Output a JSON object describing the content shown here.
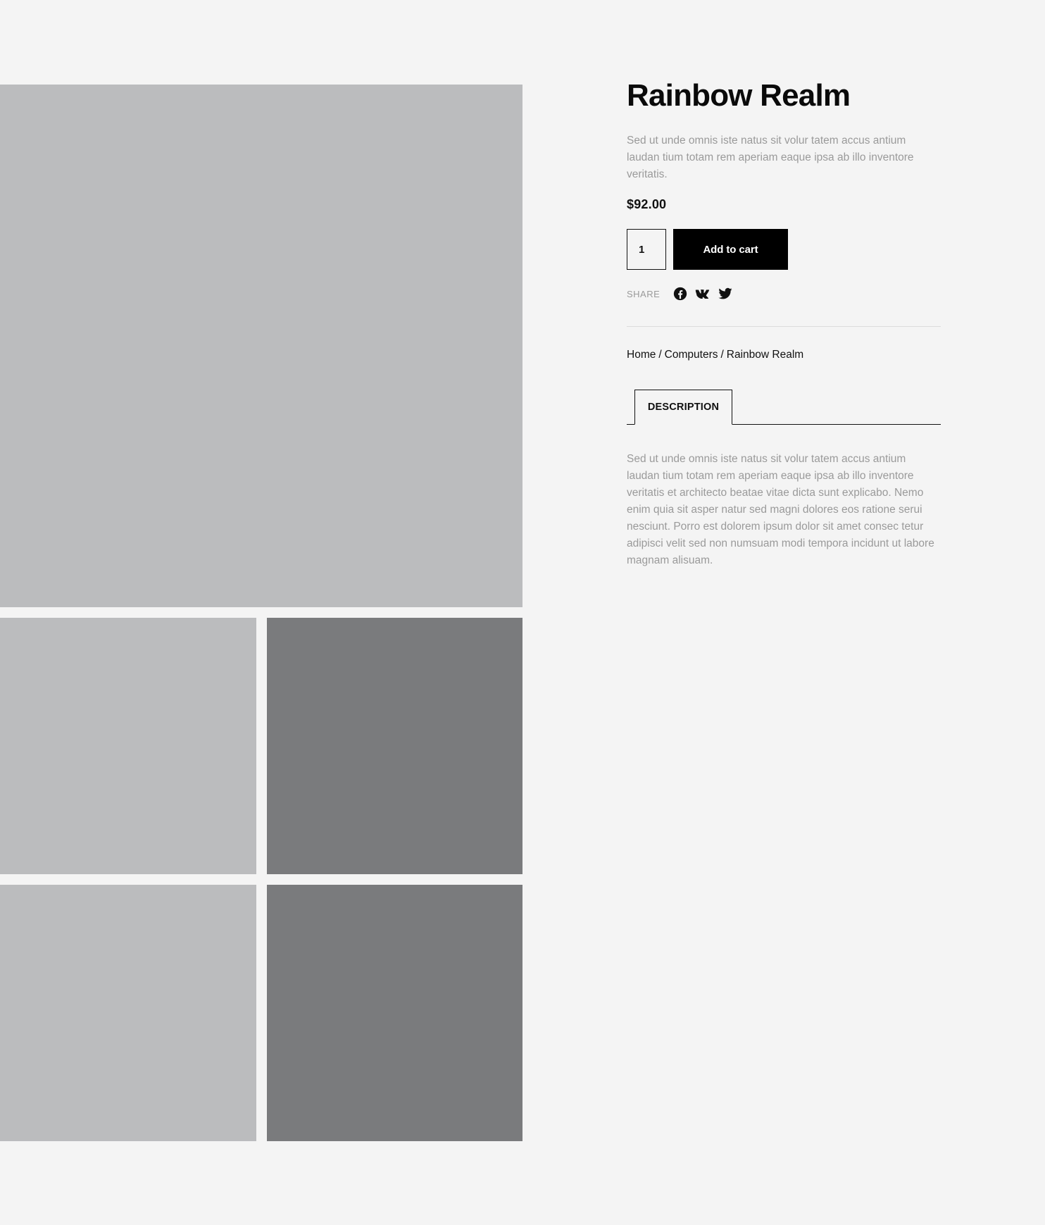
{
  "product": {
    "title": "Rainbow Realm",
    "short_description": "Sed ut unde omnis iste natus sit volur tatem accus antium laudan tium totam rem aperiam eaque ipsa ab illo inventore veritatis.",
    "price": "$92.00",
    "quantity": "1",
    "add_to_cart_label": "Add to cart"
  },
  "share": {
    "label": "SHARE",
    "icons": [
      "facebook-icon",
      "vk-icon",
      "twitter-icon"
    ]
  },
  "breadcrumb": {
    "items": [
      "Home",
      "Computers",
      "Rainbow Realm"
    ],
    "separator": "/"
  },
  "tabs": {
    "active_label": "DESCRIPTION"
  },
  "description": {
    "text": "Sed ut unde omnis iste natus sit volur tatem accus antium laudan tium totam rem aperiam eaque ipsa ab illo inventore veritatis et architecto beatae vitae dicta sunt explicabo. Nemo enim quia sit asper natur sed magni dolores eos ratione serui nesciunt. Porro est dolorem ipsum dolor sit amet consec tetur adipisci velit sed non numsuam modi tempora incidunt ut labore magnam alisuam."
  },
  "colors": {
    "background": "#f4f4f4",
    "image_light": "#bbbcbe",
    "image_dark": "#7a7b7d",
    "button": "#000000",
    "muted_text": "#9a9a9a"
  }
}
